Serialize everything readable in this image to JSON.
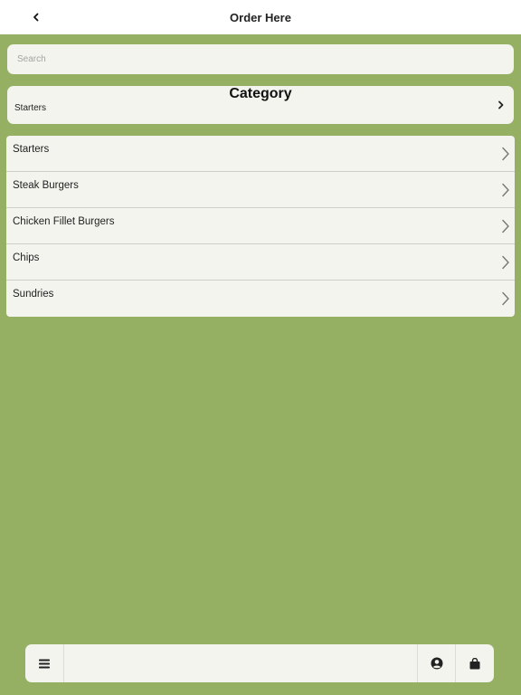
{
  "header": {
    "title": "Order Here",
    "back_icon": "chevron-left-icon"
  },
  "search": {
    "placeholder": "Search",
    "value": ""
  },
  "category": {
    "title": "Category",
    "selected": "Starters",
    "icon": "chevron-right-icon"
  },
  "menu": {
    "items": [
      {
        "label": "Starters"
      },
      {
        "label": "Steak Burgers"
      },
      {
        "label": "Chicken Fillet Burgers"
      },
      {
        "label": "Chips"
      },
      {
        "label": "Sundries"
      }
    ],
    "item_icon": "chevron-right-icon"
  },
  "toolbar": {
    "left_icon": "hamburger-menu-icon",
    "account_icon": "user-circle-icon",
    "cart_icon": "shopping-bag-icon"
  },
  "colors": {
    "background": "#95b062",
    "card": "#f3f4ee",
    "header": "#ffffff"
  }
}
